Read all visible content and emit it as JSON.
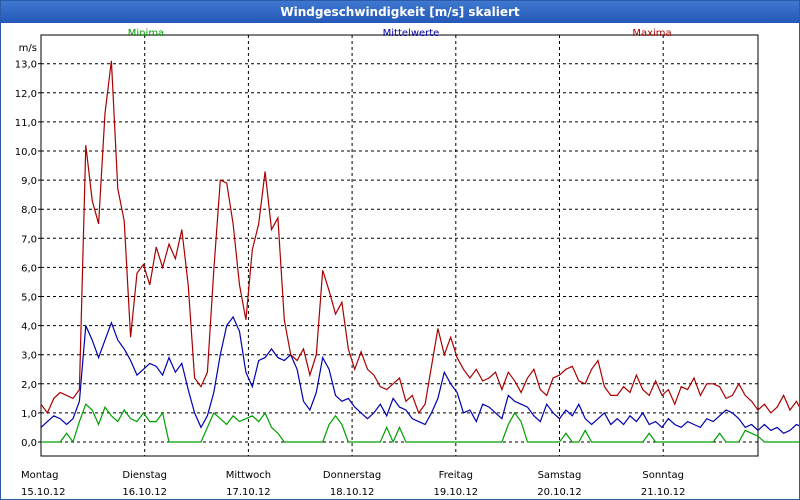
{
  "window": {
    "title": "Windgeschwindigkeit [m/s] skaliert"
  },
  "chart_data": {
    "type": "line",
    "title": "Windgeschwindigkeit [m/s] skaliert",
    "ylabel": "m/s",
    "ylim": [
      0,
      13
    ],
    "yticks": [
      "0,0",
      "1,0",
      "2,0",
      "3,0",
      "4,0",
      "5,0",
      "6,0",
      "7,0",
      "8,0",
      "9,0",
      "10,0",
      "11,0",
      "12,0",
      "13,0"
    ],
    "days": [
      {
        "name": "Montag",
        "date": "15.10.12"
      },
      {
        "name": "Dienstag",
        "date": "16.10.12"
      },
      {
        "name": "Mittwoch",
        "date": "17.10.12"
      },
      {
        "name": "Donnerstag",
        "date": "18.10.12"
      },
      {
        "name": "Freitag",
        "date": "19.10.12"
      },
      {
        "name": "Samstag",
        "date": "20.10.12"
      },
      {
        "name": "Sonntag",
        "date": "21.10.12"
      }
    ],
    "grid": true,
    "x_step_hours": 1.5,
    "series": [
      {
        "name": "Minima",
        "color": "#00a000",
        "values": [
          0,
          0,
          0,
          0,
          0.3,
          0,
          0.7,
          1.3,
          1.1,
          0.6,
          1.2,
          0.9,
          0.7,
          1.1,
          0.8,
          0.7,
          1.0,
          0.7,
          0.7,
          1.0,
          0,
          0,
          0,
          0,
          0,
          0,
          0.5,
          1.0,
          0.8,
          0.6,
          0.9,
          0.7,
          0.8,
          0.9,
          0.7,
          1.0,
          0.5,
          0.3,
          0,
          0,
          0,
          0,
          0,
          0,
          0,
          0.6,
          0.9,
          0.6,
          0,
          0,
          0,
          0,
          0,
          0,
          0.5,
          0,
          0.5,
          0,
          0,
          0,
          0,
          0,
          0,
          0,
          0,
          0,
          0,
          0,
          0,
          0,
          0,
          0,
          0,
          0.6,
          1.0,
          0.7,
          0,
          0,
          0,
          0,
          0,
          0,
          0.3,
          0,
          0,
          0.4,
          0,
          0,
          0,
          0,
          0,
          0,
          0,
          0,
          0,
          0.3,
          0,
          0,
          0,
          0,
          0,
          0,
          0,
          0,
          0,
          0,
          0.3,
          0,
          0,
          0,
          0.4,
          0.3,
          0.2,
          0,
          0,
          0,
          0,
          0,
          0,
          0,
          0.4,
          1.0,
          0.5,
          0,
          0,
          0,
          0
        ]
      },
      {
        "name": "Mittelwerte",
        "color": "#0000b0",
        "values": [
          0.5,
          0.7,
          0.9,
          0.8,
          0.6,
          0.8,
          1.4,
          4.0,
          3.5,
          2.9,
          3.5,
          4.1,
          3.5,
          3.2,
          2.8,
          2.3,
          2.5,
          2.7,
          2.6,
          2.3,
          2.9,
          2.4,
          2.7,
          1.8,
          1.0,
          0.5,
          0.9,
          1.7,
          3.0,
          4.0,
          4.3,
          3.8,
          2.4,
          1.9,
          2.8,
          2.9,
          3.2,
          2.9,
          2.8,
          3.0,
          2.5,
          1.4,
          1.1,
          1.7,
          2.9,
          2.5,
          1.6,
          1.4,
          1.5,
          1.2,
          1.0,
          0.8,
          1.0,
          1.3,
          0.9,
          1.5,
          1.2,
          1.1,
          0.8,
          0.7,
          0.6,
          1.0,
          1.5,
          2.4,
          2.0,
          1.7,
          1.0,
          1.1,
          0.7,
          1.3,
          1.2,
          1.0,
          0.8,
          1.6,
          1.4,
          1.3,
          1.2,
          0.9,
          0.7,
          1.3,
          1.0,
          0.8,
          1.1,
          0.9,
          1.3,
          0.8,
          0.6,
          0.8,
          1.0,
          0.6,
          0.8,
          0.6,
          0.9,
          0.7,
          1.0,
          0.6,
          0.7,
          0.5,
          0.8,
          0.6,
          0.5,
          0.7,
          0.6,
          0.5,
          0.8,
          0.7,
          0.9,
          1.1,
          1.0,
          0.8,
          0.5,
          0.6,
          0.4,
          0.6,
          0.4,
          0.5,
          0.3,
          0.4,
          0.6,
          0.5,
          0.7,
          0.9,
          1.6,
          1.2,
          1.0,
          2.4,
          1.4,
          0.8,
          1.0,
          1.2,
          0.8,
          0.9
        ]
      },
      {
        "name": "Maxima",
        "color": "#aa0000",
        "values": [
          1.3,
          1.0,
          1.5,
          1.7,
          1.6,
          1.5,
          1.8,
          10.2,
          8.3,
          7.5,
          11.3,
          13.1,
          8.7,
          7.6,
          3.6,
          5.8,
          6.1,
          5.4,
          6.7,
          6.0,
          6.8,
          6.3,
          7.3,
          5.4,
          2.2,
          1.9,
          2.4,
          5.9,
          9.0,
          8.9,
          7.5,
          5.4,
          4.2,
          6.6,
          7.5,
          9.3,
          7.3,
          7.7,
          4.2,
          3.0,
          2.8,
          3.2,
          2.3,
          3.0,
          5.9,
          5.2,
          4.4,
          4.8,
          3.2,
          2.5,
          3.1,
          2.5,
          2.3,
          1.9,
          1.8,
          2.0,
          2.2,
          1.4,
          1.6,
          1.0,
          1.3,
          2.6,
          3.9,
          3.0,
          3.6,
          2.9,
          2.5,
          2.2,
          2.5,
          2.1,
          2.2,
          2.4,
          1.8,
          2.4,
          2.1,
          1.7,
          2.2,
          2.5,
          1.8,
          1.6,
          2.2,
          2.3,
          2.5,
          2.6,
          2.1,
          2.0,
          2.5,
          2.8,
          1.9,
          1.6,
          1.6,
          1.9,
          1.7,
          2.3,
          1.8,
          1.6,
          2.1,
          1.6,
          1.8,
          1.3,
          1.9,
          1.8,
          2.2,
          1.6,
          2.0,
          2.0,
          1.9,
          1.5,
          1.6,
          2.0,
          1.6,
          1.4,
          1.1,
          1.3,
          1.0,
          1.2,
          1.6,
          1.1,
          1.4,
          1.0,
          1.5,
          2.7,
          2.1,
          2.3,
          2.8,
          4.5,
          3.8,
          2.5,
          2.1,
          1.9,
          1.9,
          2.0
        ]
      }
    ]
  }
}
